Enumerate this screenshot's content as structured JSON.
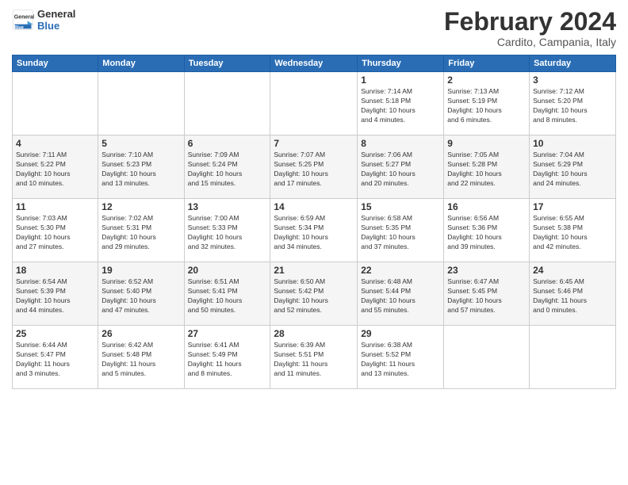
{
  "header": {
    "logo_text_general": "General",
    "logo_text_blue": "Blue",
    "month_title": "February 2024",
    "location": "Cardito, Campania, Italy"
  },
  "days_of_week": [
    "Sunday",
    "Monday",
    "Tuesday",
    "Wednesday",
    "Thursday",
    "Friday",
    "Saturday"
  ],
  "weeks": [
    [
      {
        "day": "",
        "info": ""
      },
      {
        "day": "",
        "info": ""
      },
      {
        "day": "",
        "info": ""
      },
      {
        "day": "",
        "info": ""
      },
      {
        "day": "1",
        "info": "Sunrise: 7:14 AM\nSunset: 5:18 PM\nDaylight: 10 hours\nand 4 minutes."
      },
      {
        "day": "2",
        "info": "Sunrise: 7:13 AM\nSunset: 5:19 PM\nDaylight: 10 hours\nand 6 minutes."
      },
      {
        "day": "3",
        "info": "Sunrise: 7:12 AM\nSunset: 5:20 PM\nDaylight: 10 hours\nand 8 minutes."
      }
    ],
    [
      {
        "day": "4",
        "info": "Sunrise: 7:11 AM\nSunset: 5:22 PM\nDaylight: 10 hours\nand 10 minutes."
      },
      {
        "day": "5",
        "info": "Sunrise: 7:10 AM\nSunset: 5:23 PM\nDaylight: 10 hours\nand 13 minutes."
      },
      {
        "day": "6",
        "info": "Sunrise: 7:09 AM\nSunset: 5:24 PM\nDaylight: 10 hours\nand 15 minutes."
      },
      {
        "day": "7",
        "info": "Sunrise: 7:07 AM\nSunset: 5:25 PM\nDaylight: 10 hours\nand 17 minutes."
      },
      {
        "day": "8",
        "info": "Sunrise: 7:06 AM\nSunset: 5:27 PM\nDaylight: 10 hours\nand 20 minutes."
      },
      {
        "day": "9",
        "info": "Sunrise: 7:05 AM\nSunset: 5:28 PM\nDaylight: 10 hours\nand 22 minutes."
      },
      {
        "day": "10",
        "info": "Sunrise: 7:04 AM\nSunset: 5:29 PM\nDaylight: 10 hours\nand 24 minutes."
      }
    ],
    [
      {
        "day": "11",
        "info": "Sunrise: 7:03 AM\nSunset: 5:30 PM\nDaylight: 10 hours\nand 27 minutes."
      },
      {
        "day": "12",
        "info": "Sunrise: 7:02 AM\nSunset: 5:31 PM\nDaylight: 10 hours\nand 29 minutes."
      },
      {
        "day": "13",
        "info": "Sunrise: 7:00 AM\nSunset: 5:33 PM\nDaylight: 10 hours\nand 32 minutes."
      },
      {
        "day": "14",
        "info": "Sunrise: 6:59 AM\nSunset: 5:34 PM\nDaylight: 10 hours\nand 34 minutes."
      },
      {
        "day": "15",
        "info": "Sunrise: 6:58 AM\nSunset: 5:35 PM\nDaylight: 10 hours\nand 37 minutes."
      },
      {
        "day": "16",
        "info": "Sunrise: 6:56 AM\nSunset: 5:36 PM\nDaylight: 10 hours\nand 39 minutes."
      },
      {
        "day": "17",
        "info": "Sunrise: 6:55 AM\nSunset: 5:38 PM\nDaylight: 10 hours\nand 42 minutes."
      }
    ],
    [
      {
        "day": "18",
        "info": "Sunrise: 6:54 AM\nSunset: 5:39 PM\nDaylight: 10 hours\nand 44 minutes."
      },
      {
        "day": "19",
        "info": "Sunrise: 6:52 AM\nSunset: 5:40 PM\nDaylight: 10 hours\nand 47 minutes."
      },
      {
        "day": "20",
        "info": "Sunrise: 6:51 AM\nSunset: 5:41 PM\nDaylight: 10 hours\nand 50 minutes."
      },
      {
        "day": "21",
        "info": "Sunrise: 6:50 AM\nSunset: 5:42 PM\nDaylight: 10 hours\nand 52 minutes."
      },
      {
        "day": "22",
        "info": "Sunrise: 6:48 AM\nSunset: 5:44 PM\nDaylight: 10 hours\nand 55 minutes."
      },
      {
        "day": "23",
        "info": "Sunrise: 6:47 AM\nSunset: 5:45 PM\nDaylight: 10 hours\nand 57 minutes."
      },
      {
        "day": "24",
        "info": "Sunrise: 6:45 AM\nSunset: 5:46 PM\nDaylight: 11 hours\nand 0 minutes."
      }
    ],
    [
      {
        "day": "25",
        "info": "Sunrise: 6:44 AM\nSunset: 5:47 PM\nDaylight: 11 hours\nand 3 minutes."
      },
      {
        "day": "26",
        "info": "Sunrise: 6:42 AM\nSunset: 5:48 PM\nDaylight: 11 hours\nand 5 minutes."
      },
      {
        "day": "27",
        "info": "Sunrise: 6:41 AM\nSunset: 5:49 PM\nDaylight: 11 hours\nand 8 minutes."
      },
      {
        "day": "28",
        "info": "Sunrise: 6:39 AM\nSunset: 5:51 PM\nDaylight: 11 hours\nand 11 minutes."
      },
      {
        "day": "29",
        "info": "Sunrise: 6:38 AM\nSunset: 5:52 PM\nDaylight: 11 hours\nand 13 minutes."
      },
      {
        "day": "",
        "info": ""
      },
      {
        "day": "",
        "info": ""
      }
    ]
  ]
}
